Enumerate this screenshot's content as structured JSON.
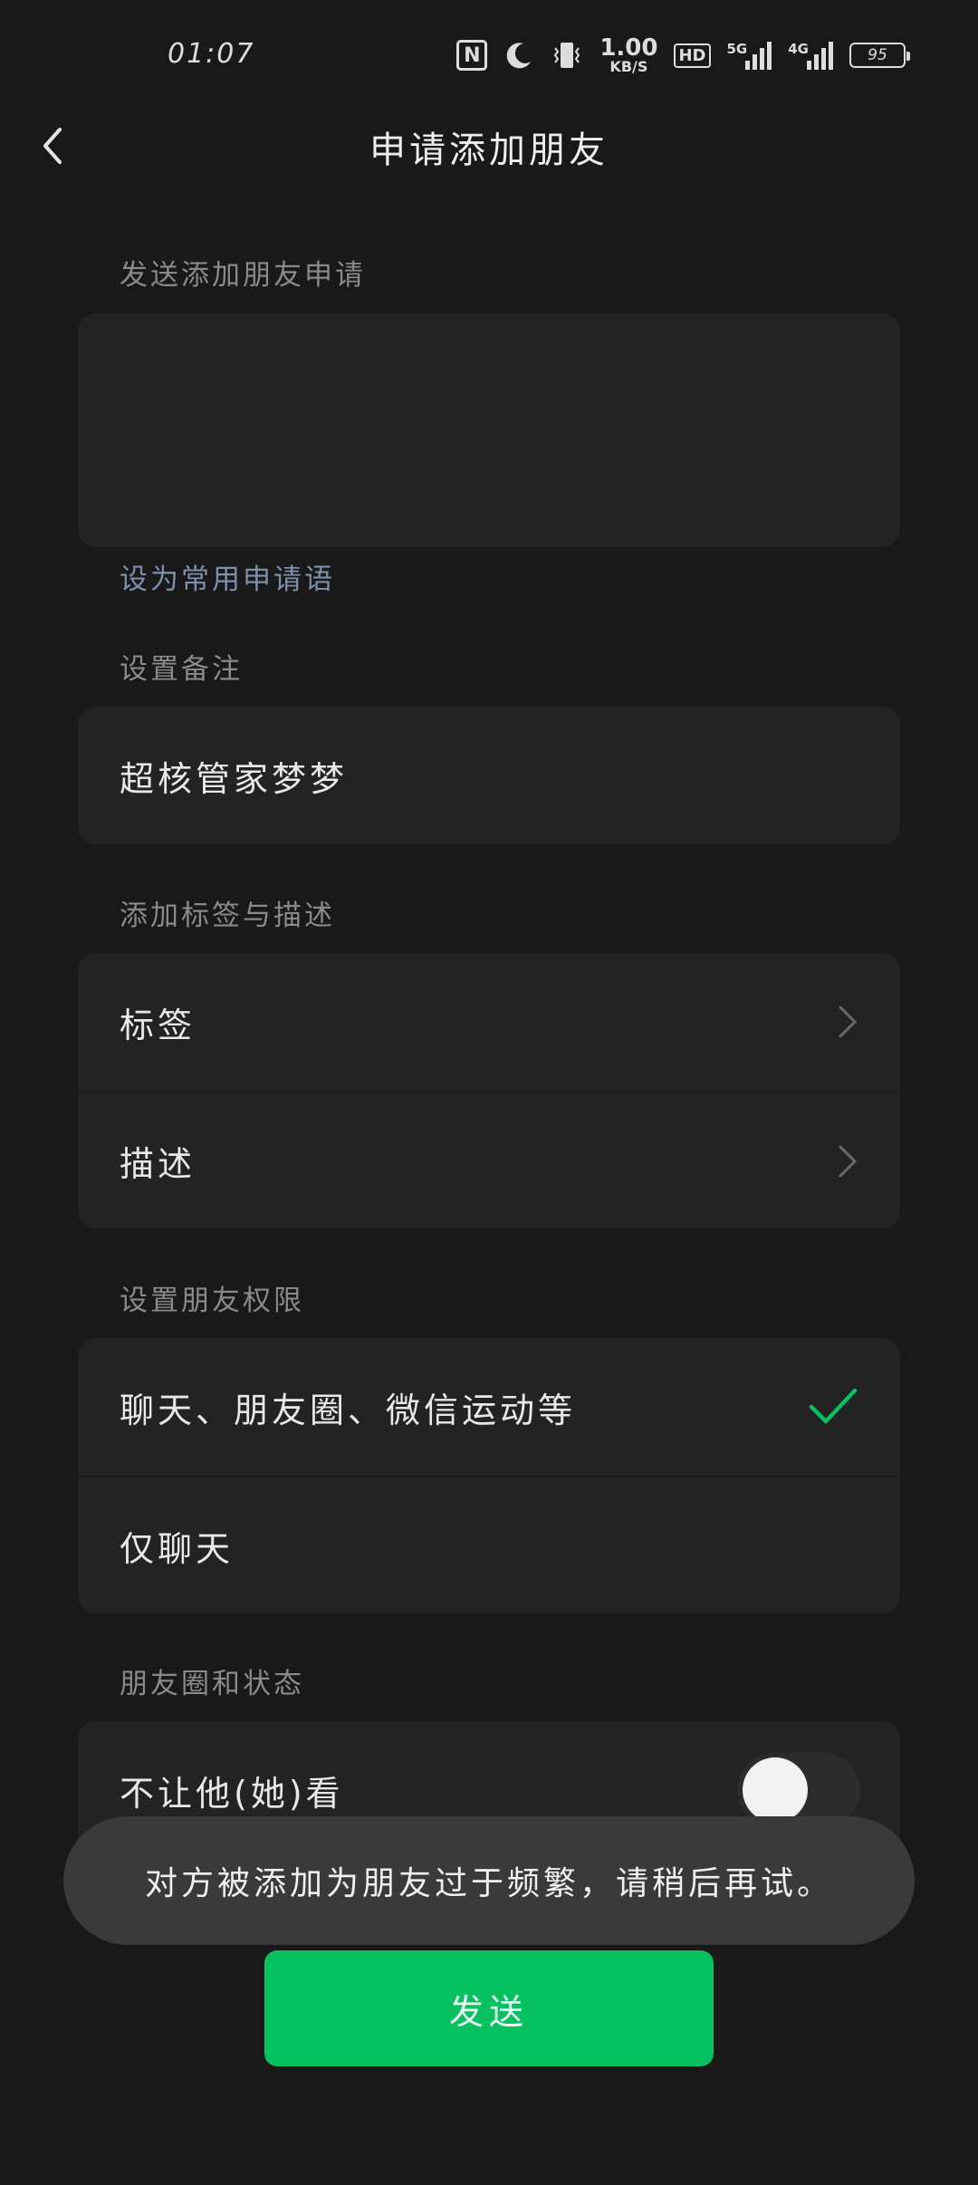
{
  "status_bar": {
    "time": "01:07",
    "nfc_label": "N",
    "speed_value": "1.00",
    "speed_unit": "KB/S",
    "hd_label": "HD",
    "net1_label": "5G",
    "net2_label": "4G",
    "battery": "95",
    "icons": [
      "nfc-icon",
      "moon-icon",
      "vibrate-icon",
      "hd-icon",
      "signal-icon",
      "battery-icon"
    ]
  },
  "header": {
    "title": "申请添加朋友",
    "back_icon": "chevron-left-icon"
  },
  "request": {
    "section_label": "发送添加朋友申请",
    "message": "",
    "set_common_link": "设为常用申请语"
  },
  "remark": {
    "section_label": "设置备注",
    "value": "超核管家梦梦"
  },
  "tags": {
    "section_label": "添加标签与描述",
    "tag_label": "标签",
    "desc_label": "描述"
  },
  "permissions": {
    "section_label": "设置朋友权限",
    "option_full": "聊天、朋友圈、微信运动等",
    "option_chat_only": "仅聊天",
    "selected": "聊天、朋友圈、微信运动等"
  },
  "moments": {
    "section_label": "朋友圈和状态",
    "hide_label": "不让他(她)看",
    "hide_enabled": false
  },
  "toast": "对方被添加为朋友过于频繁，请稍后再试。",
  "send_button": "发送",
  "colors": {
    "background": "#191919",
    "card": "#232323",
    "accent": "#07c160",
    "link": "#7d90a9"
  }
}
